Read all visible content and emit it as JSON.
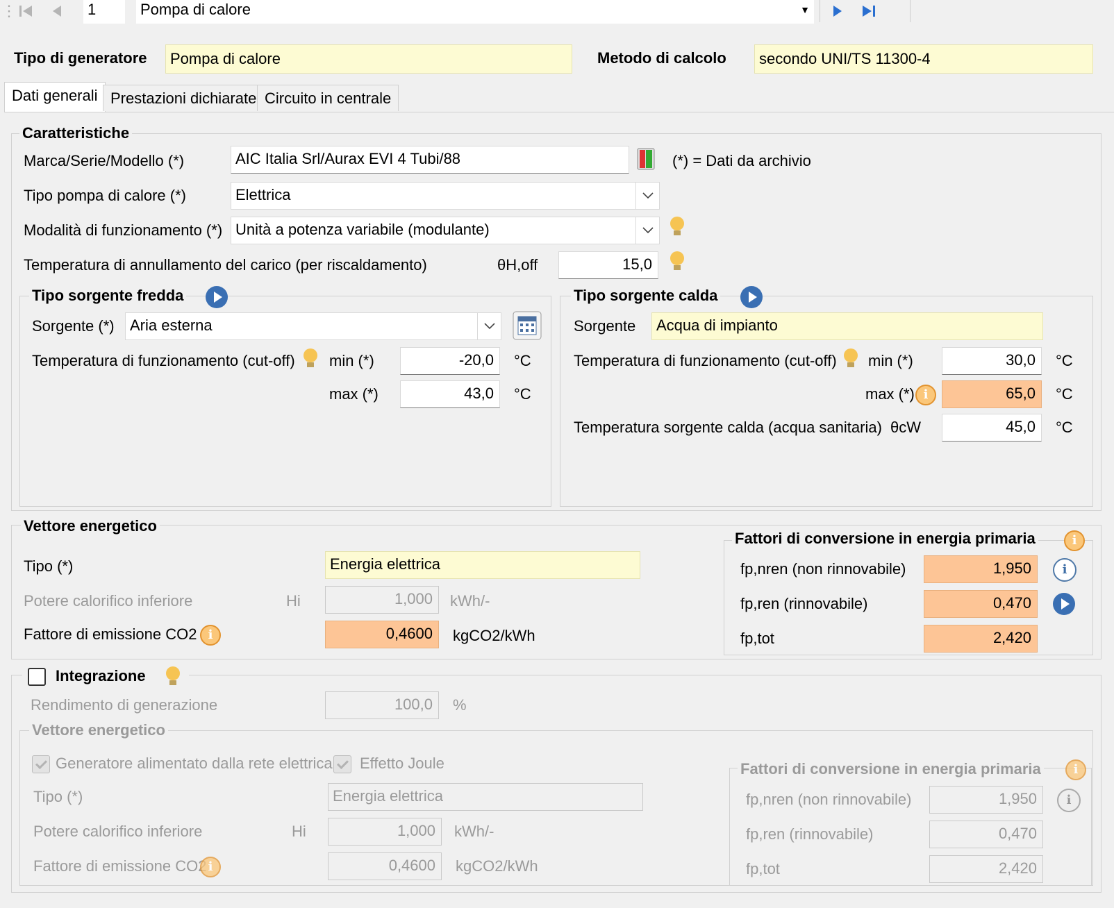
{
  "nav": {
    "record_number": "1",
    "record_name": "Pompa di calore"
  },
  "header": {
    "tipo_generatore_label": "Tipo di generatore",
    "tipo_generatore_value": "Pompa di calore",
    "metodo_calcolo_label": "Metodo di calcolo",
    "metodo_calcolo_value": "secondo UNI/TS 11300-4"
  },
  "tabs": [
    {
      "label": "Dati generali"
    },
    {
      "label": "Prestazioni dichiarate"
    },
    {
      "label": "Circuito in centrale"
    }
  ],
  "caratteristiche": {
    "title": "Caratteristiche",
    "marca_label": "Marca/Serie/Modello (*)",
    "marca_value": "AIC Italia Srl/Aurax EVI 4 Tubi/88",
    "archivio_note": "(*) = Dati da archivio",
    "tipo_pompa_label": "Tipo pompa di calore (*)",
    "tipo_pompa_value": "Elettrica",
    "modalita_label": "Modalità di funzionamento (*)",
    "modalita_value": "Unità a potenza variabile (modulante)",
    "temp_annull_label": "Temperatura di annullamento del carico (per riscaldamento)",
    "temp_annull_symbol": "θH,off",
    "temp_annull_value": "15,0"
  },
  "sorgente_fredda": {
    "title": "Tipo sorgente fredda",
    "sorgente_label": "Sorgente (*)",
    "sorgente_value": "Aria esterna",
    "temp_label": "Temperatura di funzionamento (cut-off)",
    "min_label": "min (*)",
    "min_value": "-20,0",
    "max_label": "max (*)",
    "max_value": "43,0",
    "unit": "°C"
  },
  "sorgente_calda": {
    "title": "Tipo sorgente calda",
    "sorgente_label": "Sorgente",
    "sorgente_value": "Acqua di impianto",
    "temp_label": "Temperatura di funzionamento (cut-off)",
    "min_label": "min (*)",
    "min_value": "30,0",
    "max_label": "max (*)",
    "max_value": "65,0",
    "acs_label": "Temperatura sorgente calda (acqua sanitaria)",
    "acs_symbol": "θcW",
    "acs_value": "45,0",
    "unit": "°C"
  },
  "vettore": {
    "title": "Vettore energetico",
    "tipo_label": "Tipo (*)",
    "tipo_value": "Energia elettrica",
    "potere_label": "Potere calorifico inferiore",
    "potere_symbol": "Hi",
    "potere_value": "1,000",
    "potere_unit": "kWh/-",
    "emissione_label": "Fattore di emissione CO2",
    "emissione_value": "0,4600",
    "emissione_unit": "kgCO2/kWh",
    "fattori_title": "Fattori di conversione in energia primaria",
    "fp_nren_label": "fp,nren (non rinnovabile)",
    "fp_nren_value": "1,950",
    "fp_ren_label": "fp,ren (rinnovabile)",
    "fp_ren_value": "0,470",
    "fp_tot_label": "fp,tot",
    "fp_tot_value": "2,420"
  },
  "integrazione": {
    "title": "Integrazione",
    "checked": false,
    "rendimento_label": "Rendimento di generazione",
    "rendimento_value": "100,0",
    "rendimento_unit": "%",
    "vettore_title": "Vettore energetico",
    "rete_label": "Generatore alimentato dalla rete elettrica",
    "joule_label": "Effetto Joule",
    "tipo_label": "Tipo (*)",
    "tipo_value": "Energia elettrica",
    "potere_label": "Potere calorifico inferiore",
    "potere_symbol": "Hi",
    "potere_value": "1,000",
    "potere_unit": "kWh/-",
    "emissione_label": "Fattore di emissione CO2",
    "emissione_value": "0,4600",
    "emissione_unit": "kgCO2/kWh",
    "fattori_title": "Fattori di conversione in energia primaria",
    "fp_nren_label": "fp,nren (non rinnovabile)",
    "fp_nren_value": "1,950",
    "fp_ren_label": "fp,ren (rinnovabile)",
    "fp_ren_value": "0,470",
    "fp_tot_label": "fp,tot",
    "fp_tot_value": "2,420"
  },
  "colors": {
    "yellow_field": "#fdfbd3",
    "orange_field": "#fdc596",
    "accent_blue": "#3a6fb3"
  }
}
